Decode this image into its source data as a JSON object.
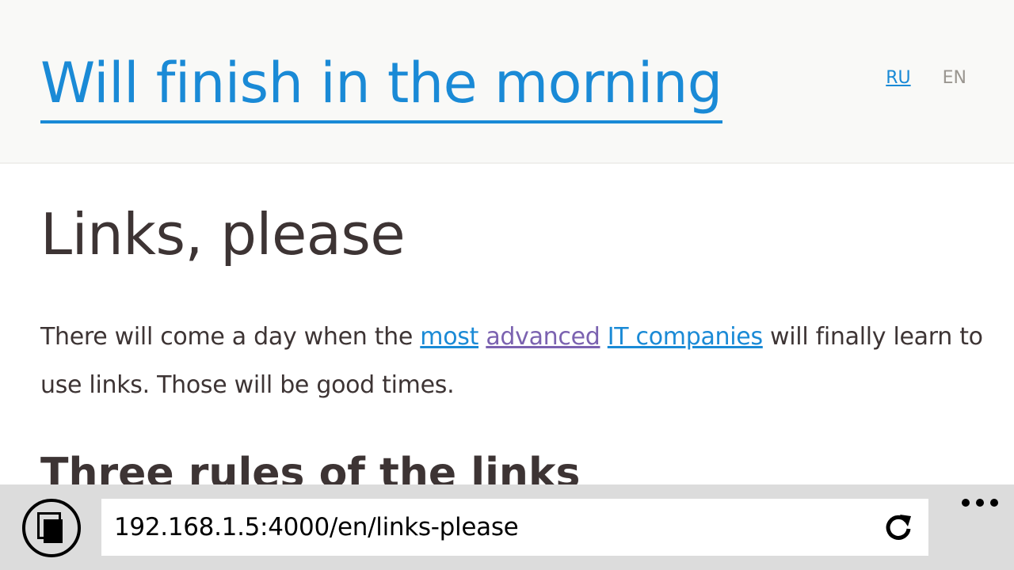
{
  "header": {
    "site_title": "Will finish in the morning",
    "languages": [
      {
        "code": "RU",
        "active": false
      },
      {
        "code": "EN",
        "active": true
      }
    ]
  },
  "article": {
    "title": "Links, please",
    "paragraph": {
      "text_before": "There will come a day when the ",
      "link_1": "most",
      "link_2": "advanced",
      "link_3": "IT companies",
      "text_after": " will finally learn to use links. Those will be good times."
    },
    "section_title": "Three rules of the links"
  },
  "browser": {
    "address": "192.168.1.5:4000/en/links-please",
    "tabs_icon": "tabs-icon",
    "refresh_icon": "refresh-icon",
    "more_icon": "more-dots-icon"
  },
  "colors": {
    "link": "#1a8ad6",
    "visited_link": "#7b62b0",
    "text": "#3d3434",
    "header_bg": "#f9f9f7",
    "browser_bar_bg": "#dcdcdc"
  }
}
